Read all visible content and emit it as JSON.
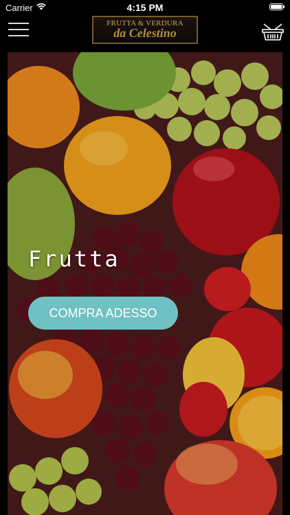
{
  "status_bar": {
    "carrier": "Carrier",
    "time": "4:15 PM"
  },
  "nav": {
    "menu_icon": "hamburger-menu-icon",
    "logo_line1": "FRUTTA & VERDURA",
    "logo_line2": "da Celestino",
    "cart_icon": "basket-icon"
  },
  "hero": {
    "title": "Frutta",
    "cta_label": "COMPRA ADESSO"
  },
  "colors": {
    "cta": "#6fc1c3",
    "logo_gold": "#c9a35a",
    "background": "#000000"
  }
}
